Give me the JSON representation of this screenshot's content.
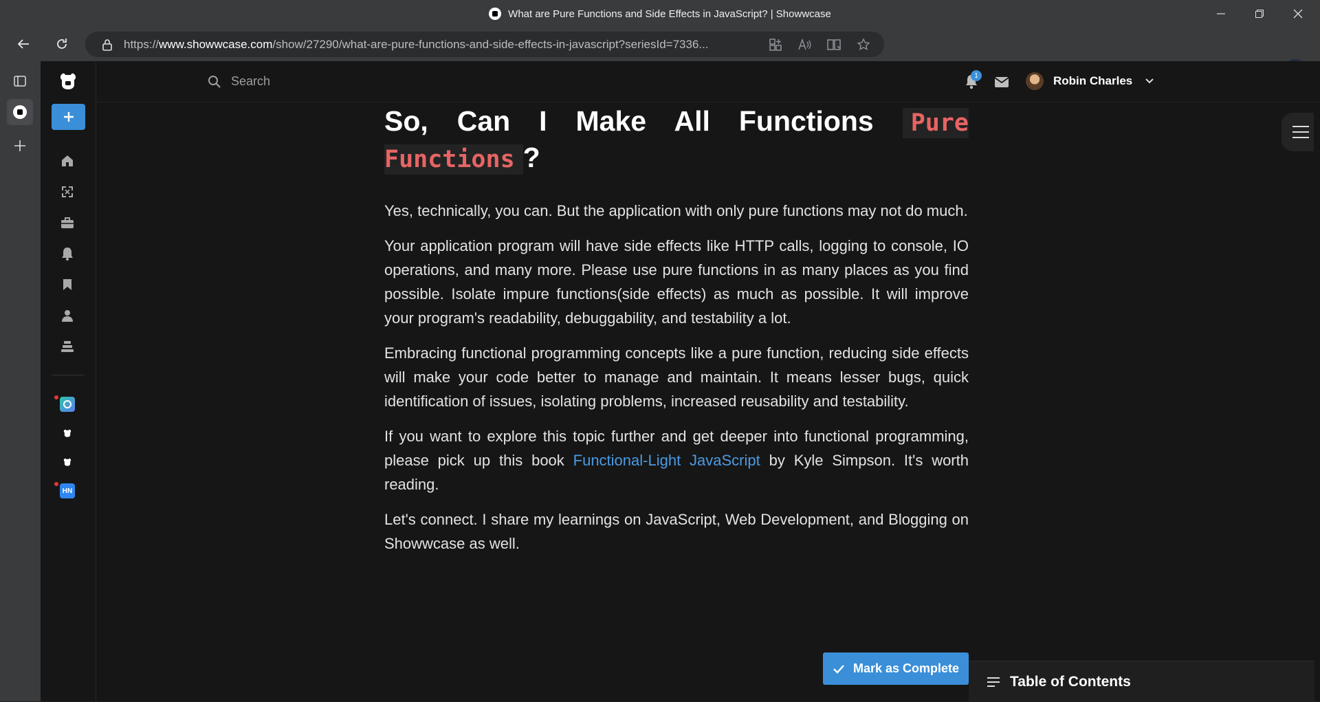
{
  "browser": {
    "tab_title": "What are Pure Functions and Side Effects in JavaScript? | Showwcase",
    "url_prefix": "https://",
    "url_domain": "www.showwcase.com",
    "url_path": "/show/27290/what-are-pure-functions-and-side-effects-in-javascript?seriesId=7336...",
    "icons": [
      "back-icon",
      "refresh-icon",
      "lock-icon",
      "apps-icon",
      "read-aloud-icon",
      "immersive-reader-icon",
      "favorite-star-icon",
      "shield-extension-icon",
      "grammarly-icon",
      "extension-red-icon",
      "puzzle-extensions-icon",
      "split-screen-icon",
      "favorites-icon",
      "collections-icon",
      "health-icon",
      "profile-avatar",
      "more-icon",
      "bing-icon"
    ]
  },
  "edge_sidebar": {
    "icons": [
      "tab-actions-icon",
      "showwcase-tab-icon",
      "new-tab-plus-icon"
    ]
  },
  "app": {
    "brand_color": "#3b8fd9",
    "nav_icons": [
      "home-icon",
      "expand-icon",
      "briefcase-icon",
      "bell-icon",
      "bookmark-icon",
      "profile-icon",
      "stack-icon"
    ],
    "communities": [
      {
        "name": "community-colorful",
        "badge": ""
      },
      {
        "name": "community-showwcase-1",
        "badge": ""
      },
      {
        "name": "community-showwcase-2",
        "badge": ""
      },
      {
        "name": "community-hn",
        "badge": "HN"
      }
    ]
  },
  "header": {
    "search_placeholder": "Search",
    "notification_count": "1",
    "user_name": "Robin Charles"
  },
  "article": {
    "heading_part1": "So, Can I Make All Functions ",
    "heading_code": "Pure Functions",
    "heading_end": "?",
    "p1": "Yes, technically, you can. But the application with only pure functions may not do much.",
    "p2": "Your application program will have side effects like HTTP calls, logging to console, IO operations, and many more. Please use pure functions in as many places as you find possible. Isolate impure functions(side effects) as much as possible. It will improve your program's readability, debuggability, and testability a lot.",
    "p3": "Embracing functional programming concepts like a pure function, reducing side effects will make your code better to manage and maintain. It means lesser bugs, quick identification of issues, isolating problems, increased reusability and testability.",
    "p4_before": "If you want to explore this topic further and get deeper into functional programming, please pick up this book ",
    "p4_link": "Functional-Light JavaScript",
    "p4_after": " by Kyle Simpson. It's worth reading.",
    "p5": "Let's connect. I share my learnings on JavaScript, Web Development, and Blogging on Showwcase as well."
  },
  "actions": {
    "mark_complete": "Mark as Complete",
    "toc_label": "Table of Contents"
  }
}
